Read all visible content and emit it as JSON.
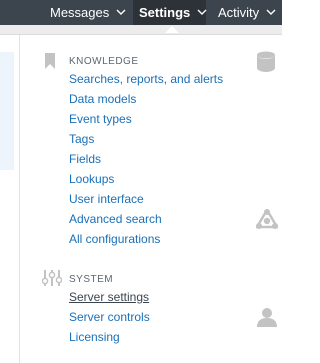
{
  "topnav": {
    "items": [
      {
        "label": "Messages"
      },
      {
        "label": "Settings"
      },
      {
        "label": "Activity"
      }
    ]
  },
  "knowledge": {
    "title": "KNOWLEDGE",
    "links": [
      {
        "label": "Searches, reports, and alerts"
      },
      {
        "label": "Data models"
      },
      {
        "label": "Event types"
      },
      {
        "label": "Tags"
      },
      {
        "label": "Fields"
      },
      {
        "label": "Lookups"
      },
      {
        "label": "User interface"
      },
      {
        "label": "Advanced search"
      },
      {
        "label": "All configurations"
      }
    ]
  },
  "system": {
    "title": "SYSTEM",
    "links": [
      {
        "label": "Server settings"
      },
      {
        "label": "Server controls"
      },
      {
        "label": "Licensing"
      }
    ]
  },
  "colors": {
    "nav_bg": "#3c444d",
    "nav_active_bg": "#2c3238",
    "link": "#1a70b8",
    "icon_grey": "#c3c3c3"
  }
}
